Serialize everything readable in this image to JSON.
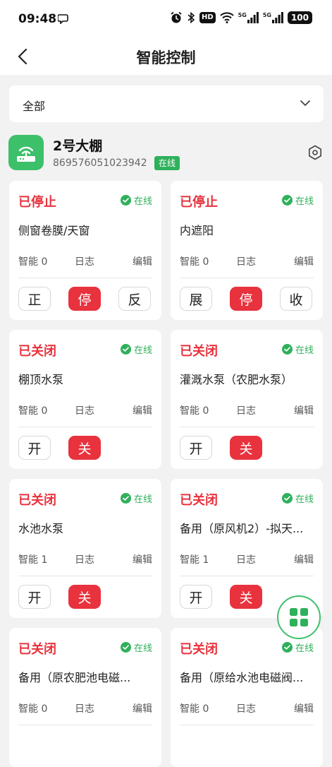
{
  "status_bar": {
    "time": "09:48",
    "hd_badge": "HD",
    "sim1_label": "5G",
    "sim2_label": "5G",
    "battery": "100"
  },
  "nav": {
    "title": "智能控制"
  },
  "filter": {
    "selected": "全部"
  },
  "device": {
    "name": "2号大棚",
    "id": "869576051023942",
    "status": "在线"
  },
  "colors": {
    "accent_green": "#2fb05b",
    "alert_red": "#e8323d"
  },
  "cards": [
    {
      "status": "已停止",
      "online": "在线",
      "name": "侧窗卷膜/天窗",
      "smart": "智能 0",
      "log": "日志",
      "edit": "编辑",
      "buttons": [
        {
          "label": "正",
          "active": false
        },
        {
          "label": "停",
          "active": true
        },
        {
          "label": "反",
          "active": false
        }
      ]
    },
    {
      "status": "已停止",
      "online": "在线",
      "name": "内遮阳",
      "smart": "智能 0",
      "log": "日志",
      "edit": "编辑",
      "buttons": [
        {
          "label": "展",
          "active": false
        },
        {
          "label": "停",
          "active": true
        },
        {
          "label": "收",
          "active": false
        }
      ]
    },
    {
      "status": "已关闭",
      "online": "在线",
      "name": "棚顶水泵",
      "smart": "智能 0",
      "log": "日志",
      "edit": "编辑",
      "buttons": [
        {
          "label": "开",
          "active": false
        },
        {
          "label": "关",
          "active": true
        }
      ]
    },
    {
      "status": "已关闭",
      "online": "在线",
      "name": "灌溉水泵（农肥水泵）",
      "smart": "智能 0",
      "log": "日志",
      "edit": "编辑",
      "buttons": [
        {
          "label": "开",
          "active": false
        },
        {
          "label": "关",
          "active": true
        }
      ]
    },
    {
      "status": "已关闭",
      "online": "在线",
      "name": "水池水泵",
      "smart": "智能 1",
      "log": "日志",
      "edit": "编辑",
      "buttons": [
        {
          "label": "开",
          "active": false
        },
        {
          "label": "关",
          "active": true
        }
      ]
    },
    {
      "status": "已关闭",
      "online": "在线",
      "name": "备用（原风机2）-拟天...",
      "smart": "智能 1",
      "log": "日志",
      "edit": "编辑",
      "buttons": [
        {
          "label": "开",
          "active": false
        },
        {
          "label": "关",
          "active": true
        }
      ]
    },
    {
      "status": "已关闭",
      "online": "在线",
      "name": "备用（原农肥池电磁...",
      "smart": "智能 0",
      "log": "日志",
      "edit": "编辑",
      "buttons": []
    },
    {
      "status": "已关闭",
      "online": "在线",
      "name": "备用（原给水池电磁阀...",
      "smart": "智能 0",
      "log": "日志",
      "edit": "编辑",
      "buttons": []
    }
  ]
}
